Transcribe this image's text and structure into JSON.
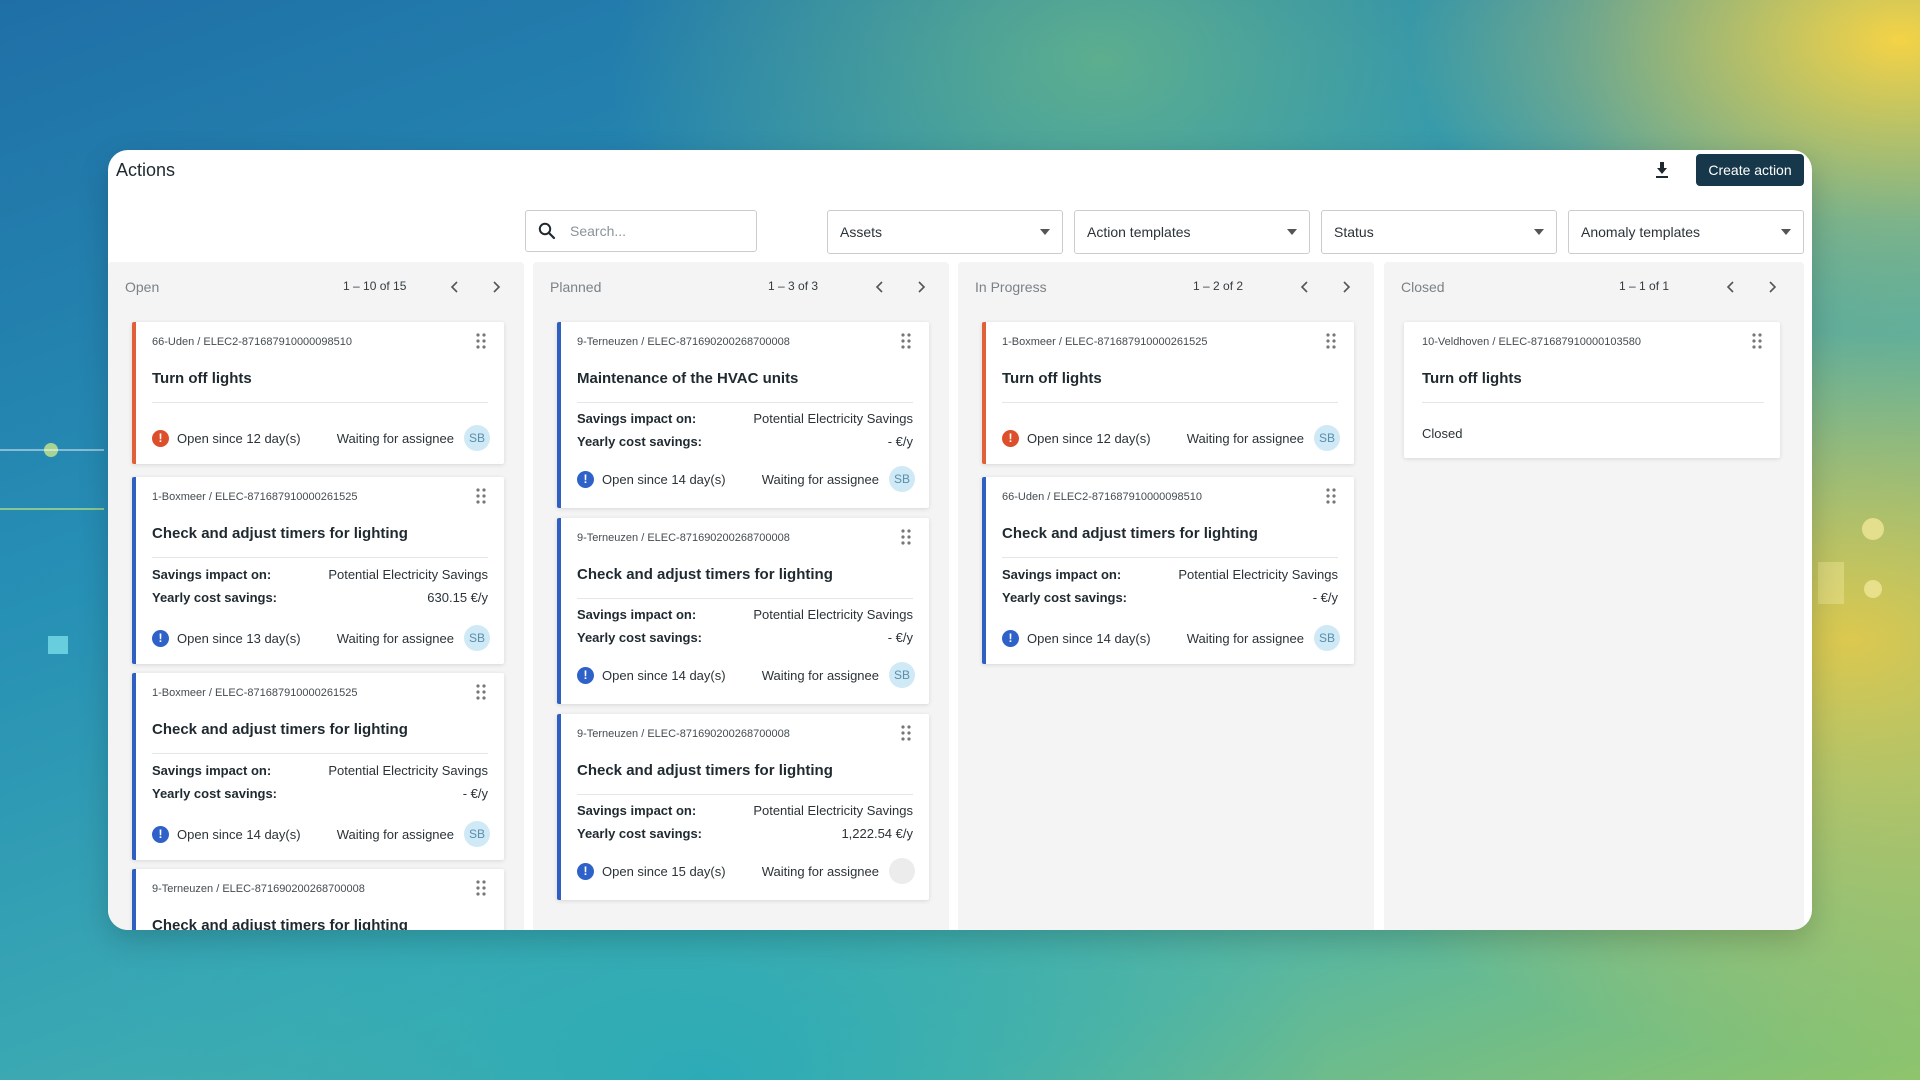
{
  "header": {
    "title": "Actions",
    "create_label": "Create action"
  },
  "filters": {
    "search_placeholder": "Search...",
    "assets": "Assets",
    "action_templates": "Action templates",
    "status": "Status",
    "anomaly_templates": "Anomaly templates"
  },
  "columns": [
    {
      "title": "Open",
      "range": "1 – 10 of 15",
      "cards": [
        {
          "path": "66-Uden / ELEC2-871687910000098510",
          "title": "Turn off lights",
          "since": "Open since 12 day(s)",
          "waiting": "Waiting for assignee",
          "assignee": "SB"
        },
        {
          "path": "1-Boxmeer / ELEC-871687910000261525",
          "title": "Check and adjust timers for lighting",
          "savings_label": "Savings impact on:",
          "savings_value": "Potential Electricity Savings",
          "yearly_label": "Yearly cost savings:",
          "yearly_value": "630.15 €/y",
          "since": "Open since 13 day(s)",
          "waiting": "Waiting for assignee",
          "assignee": "SB"
        },
        {
          "path": "1-Boxmeer / ELEC-871687910000261525",
          "title": "Check and adjust timers for lighting",
          "savings_label": "Savings impact on:",
          "savings_value": "Potential Electricity Savings",
          "yearly_label": "Yearly cost savings:",
          "yearly_value": "- €/y",
          "since": "Open since 14 day(s)",
          "waiting": "Waiting for assignee",
          "assignee": "SB"
        },
        {
          "path": "9-Terneuzen / ELEC-871690200268700008",
          "title": "Check and adjust timers for lighting"
        }
      ]
    },
    {
      "title": "Planned",
      "range": "1 – 3 of 3",
      "cards": [
        {
          "path": "9-Terneuzen / ELEC-871690200268700008",
          "title": "Maintenance of the HVAC units",
          "savings_label": "Savings impact on:",
          "savings_value": "Potential Electricity Savings",
          "yearly_label": "Yearly cost savings:",
          "yearly_value": "- €/y",
          "since": "Open since 14 day(s)",
          "waiting": "Waiting for assignee",
          "assignee": "SB"
        },
        {
          "path": "9-Terneuzen / ELEC-871690200268700008",
          "title": "Check and adjust timers for lighting",
          "savings_label": "Savings impact on:",
          "savings_value": "Potential Electricity Savings",
          "yearly_label": "Yearly cost savings:",
          "yearly_value": "- €/y",
          "since": "Open since 14 day(s)",
          "waiting": "Waiting for assignee",
          "assignee": "SB"
        },
        {
          "path": "9-Terneuzen / ELEC-871690200268700008",
          "title": "Check and adjust timers for lighting",
          "savings_label": "Savings impact on:",
          "savings_value": "Potential Electricity Savings",
          "yearly_label": "Yearly cost savings:",
          "yearly_value": "1,222.54 €/y",
          "since": "Open since 15 day(s)",
          "waiting": "Waiting for assignee",
          "assignee": ""
        }
      ]
    },
    {
      "title": "In Progress",
      "range": "1 – 2 of 2",
      "cards": [
        {
          "path": "1-Boxmeer / ELEC-871687910000261525",
          "title": "Turn off lights",
          "since": "Open since 12 day(s)",
          "waiting": "Waiting for assignee",
          "assignee": "SB"
        },
        {
          "path": "66-Uden / ELEC2-871687910000098510",
          "title": "Check and adjust timers for lighting",
          "savings_label": "Savings impact on:",
          "savings_value": "Potential Electricity Savings",
          "yearly_label": "Yearly cost savings:",
          "yearly_value": "- €/y",
          "since": "Open since 14 day(s)",
          "waiting": "Waiting for assignee",
          "assignee": "SB"
        }
      ]
    },
    {
      "title": "Closed",
      "range": "1 – 1 of 1",
      "cards": [
        {
          "path": "10-Veldhoven / ELEC-871687910000103580",
          "title": "Turn off lights",
          "status_text": "Closed"
        }
      ]
    }
  ],
  "colors": {
    "primary_button": "#17384a",
    "accent_blue": "#2f5fc0",
    "accent_red": "#e0603a",
    "avatar_bg": "#cfe9f6"
  },
  "icons": [
    "search-icon",
    "download-icon",
    "chevron-down-icon",
    "chevron-left-icon",
    "chevron-right-icon",
    "drag-handle-icon",
    "alert-icon"
  ]
}
